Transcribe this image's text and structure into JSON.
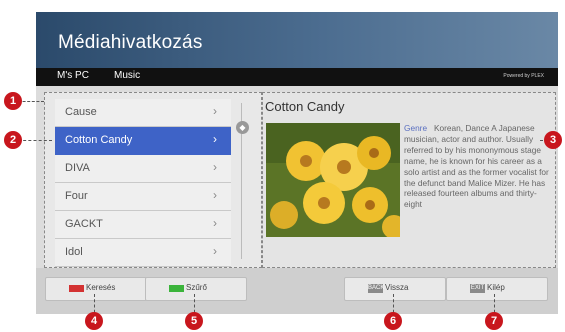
{
  "header": {
    "title": "Médiahivatkozás",
    "breadcrumb": [
      "M's PC",
      "Music"
    ],
    "powered": "Powered by PLEX"
  },
  "list": {
    "items": [
      {
        "label": "Cause",
        "selected": false
      },
      {
        "label": "Cotton Candy",
        "selected": true
      },
      {
        "label": "DIVA",
        "selected": false
      },
      {
        "label": "Four",
        "selected": false
      },
      {
        "label": "GACKT",
        "selected": false
      },
      {
        "label": "Idol",
        "selected": false
      }
    ],
    "chevron": "›",
    "scroll_glyph": "◆"
  },
  "detail": {
    "title": "Cotton Candy",
    "genre_label": "Genre",
    "genre_value": "Korean, Dance",
    "description": "A Japanese musician, actor and author. Usually referred to by his mononymous stage name, he is known for his career as a solo artist and as the former vocalist for the defunct band Malice Mizer. He has released fourteen albums and thirty-eight"
  },
  "buttons": [
    {
      "label": "Keresés",
      "color": "#d33232",
      "icon": "red-button-icon"
    },
    {
      "label": "Szűrő",
      "color": "#3bb43b",
      "icon": "green-button-icon"
    },
    {
      "label": "Vissza",
      "glyph": "BACK",
      "icon": "back-icon"
    },
    {
      "label": "Kilép",
      "glyph": "EXIT",
      "icon": "exit-icon"
    }
  ],
  "markers": [
    "1",
    "2",
    "3",
    "4",
    "5",
    "6",
    "7"
  ],
  "colors": {
    "marker": "#c8161d",
    "selection": "#3e63c7",
    "header": "#3a5a7c"
  }
}
